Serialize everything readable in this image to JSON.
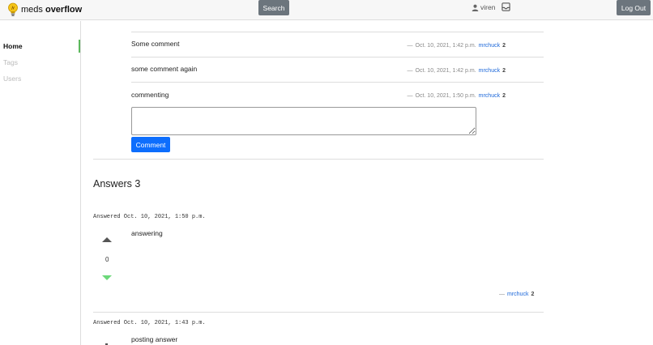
{
  "header": {
    "logo_light": "meds",
    "logo_bold": "overflow",
    "search_label": "Search",
    "username": "viren",
    "logout_label": "Log Out"
  },
  "sidebar": {
    "items": [
      {
        "label": "Home",
        "active": true
      },
      {
        "label": "Tags",
        "active": false
      },
      {
        "label": "Users",
        "active": false
      }
    ]
  },
  "comments": [
    {
      "text": "Some comment",
      "dash": "—",
      "date": "Oct. 10, 2021, 1:42 p.m.",
      "author": "mrchuck",
      "rep": "2"
    },
    {
      "text": "some comment again",
      "dash": "—",
      "date": "Oct. 10, 2021, 1:42 p.m.",
      "author": "mrchuck",
      "rep": "2"
    },
    {
      "text": "commenting",
      "dash": "—",
      "date": "Oct. 10, 2021, 1:50 p.m.",
      "author": "mrchuck",
      "rep": "2"
    }
  ],
  "comment_form": {
    "value": "",
    "button_label": "Comment"
  },
  "answers": {
    "heading": "Answers 3",
    "items": [
      {
        "answered": "Answered Oct. 10, 2021, 1:50 p.m.",
        "body": "answering",
        "votes": "0",
        "dash": "—",
        "author": "mrchuck",
        "rep": "2"
      },
      {
        "answered": "Answered Oct. 10, 2021, 1:43 p.m.",
        "body": "posting answer"
      }
    ]
  },
  "colors": {
    "primary": "#0d6efd",
    "secondary": "#6c757d",
    "active_bar": "#5cb85c",
    "downvote": "#6cd87a"
  }
}
